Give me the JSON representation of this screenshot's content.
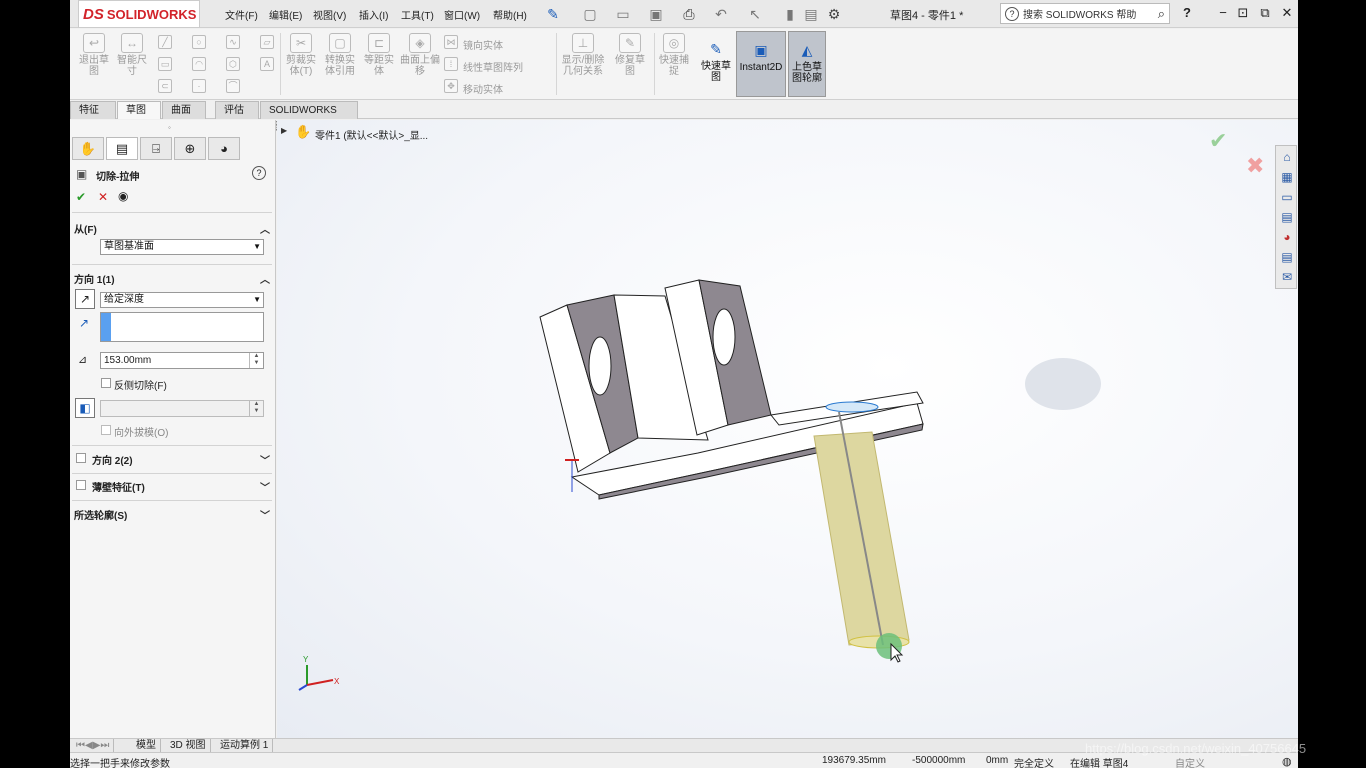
{
  "titlebar": {
    "logo_prefix": "DS",
    "logo_text": "SOLIDWORKS",
    "menus": [
      "文件(F)",
      "编辑(E)",
      "视图(V)",
      "插入(I)",
      "工具(T)",
      "窗口(W)",
      "帮助(H)"
    ],
    "doc_title": "草图4 - 零件1 *",
    "search_placeholder": "搜索 SOLIDWORKS 帮助",
    "help": "?",
    "controls": [
      "−",
      "⊡",
      "✕"
    ]
  },
  "commands": {
    "exit_sketch": "退出草图",
    "smart_dim": "智能尺寸",
    "trim": "剪裁实体(T)",
    "convert": "转换实体引用",
    "offset": "等距实体",
    "surface_offset": "曲面上偏移",
    "mirror": "镜向实体",
    "linear_pattern": "线性草图阵列",
    "move": "移动实体",
    "show_relations": "显示/删除几何关系",
    "repair": "修复草图",
    "quick_snap": "快速捕捉",
    "rapid_sketch": "快速草图",
    "instant2d": "Instant2D",
    "shaded_contours": "上色草图轮廓"
  },
  "tabs": [
    "特征",
    "草图",
    "曲面",
    "评估",
    "SOLIDWORKS 插件"
  ],
  "active_tab": 1,
  "panel": {
    "title": "切除-拉伸",
    "help_icon": "?",
    "ok": "✔",
    "cancel": "✕",
    "preview": "👁",
    "from_label": "从(F)",
    "from_value": "草图基准面",
    "dir1_label": "方向 1(1)",
    "dir1_end": "给定深度",
    "depth": "153.00mm",
    "flip_side": "反侧切除(F)",
    "draft_outward": "向外拔模(O)",
    "dir2_label": "方向 2(2)",
    "thin_label": "薄壁特征(T)",
    "contours_label": "所选轮廓(S)"
  },
  "tree": {
    "root": "零件1  (默认<<默认>_显..."
  },
  "bottom_tabs": [
    "模型",
    "3D 视图",
    "运动算例 1"
  ],
  "status": {
    "hint": "选择一把手来修改参数",
    "x": "193679.35mm",
    "y": "-500000mm",
    "z": "0mm",
    "state": "完全定义",
    "editing": "在编辑 草图4",
    "custom": "自定义"
  },
  "watermark": "https://blog.csdn.net/weixin_40756645"
}
